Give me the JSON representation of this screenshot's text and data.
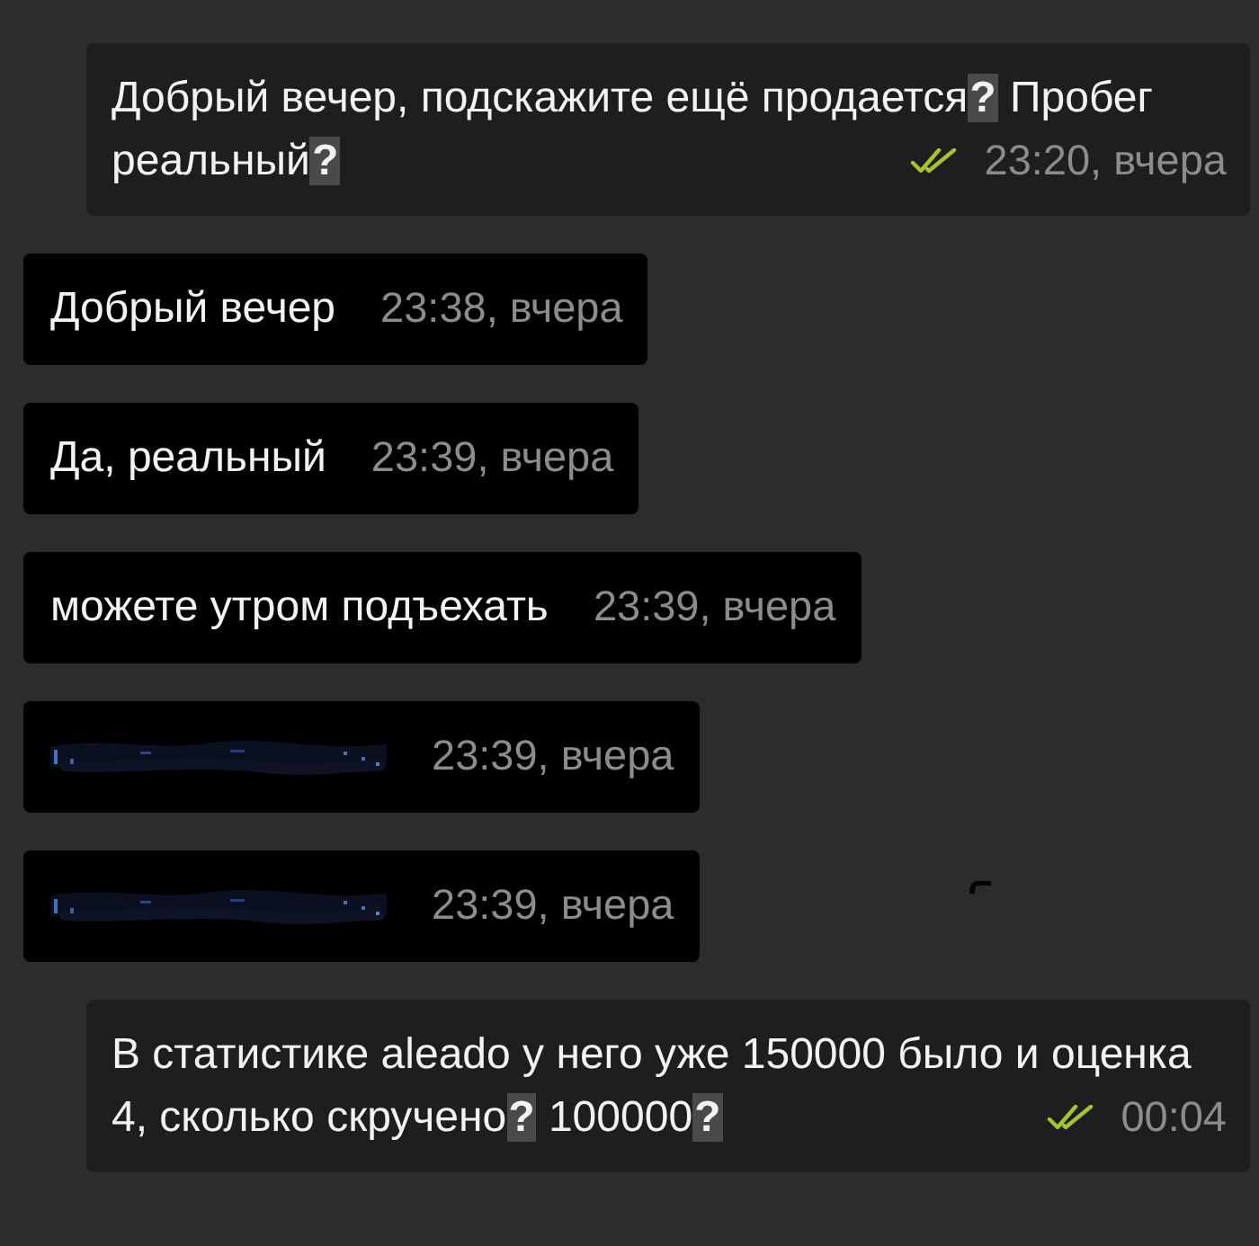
{
  "messages": [
    {
      "kind": "outgoing",
      "text": "Добрый вечер, подскажите ещё продается**?** Пробег реальный**?**",
      "time": "23:20, вчера",
      "read": true
    },
    {
      "kind": "incoming",
      "text": "Добрый вечер",
      "time": "23:38, вчера"
    },
    {
      "kind": "incoming",
      "text": "Да, реальный",
      "time": "23:39, вчера"
    },
    {
      "kind": "incoming",
      "text": "можете утром подъехать",
      "time": "23:39, вчера"
    },
    {
      "kind": "redacted",
      "time": "23:39, вчера"
    },
    {
      "kind": "redacted",
      "time": "23:39, вчера"
    },
    {
      "kind": "outgoing",
      "text": "В статистике aleado у него уже 150000 было и оценка 4, сколько скручено**?** 100000**?**",
      "time": "00:04",
      "read": true
    }
  ]
}
